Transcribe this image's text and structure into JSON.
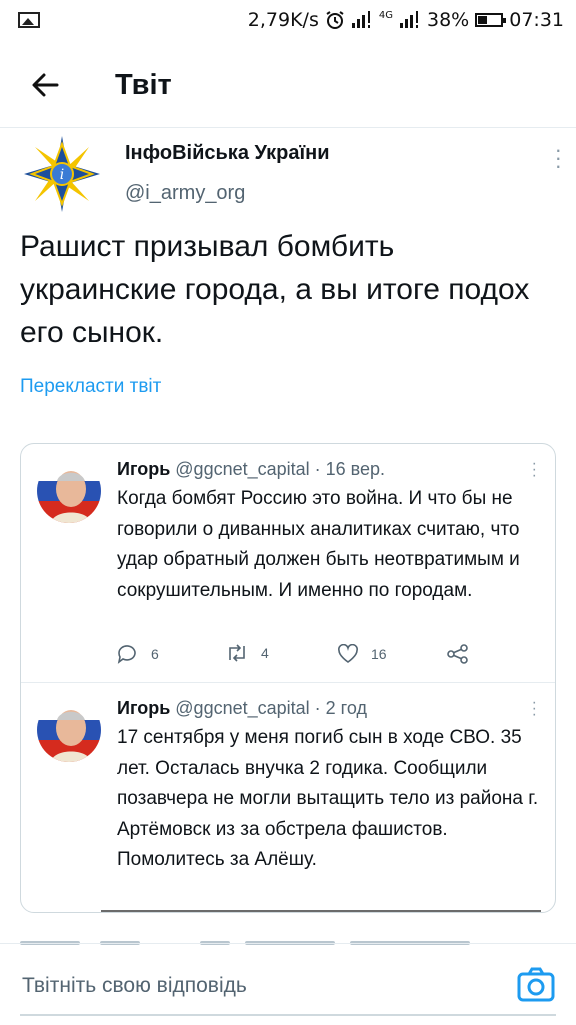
{
  "status_bar": {
    "left_icon": "image-icon",
    "net_speed": "2,79K/s",
    "network": "4G",
    "battery": "38%",
    "time": "07:31"
  },
  "header": {
    "title": "Твіт",
    "back_icon": "arrow-left-icon"
  },
  "tweet": {
    "author_name": "ІнфоВійська України",
    "author_handle": "@i_army_org",
    "text": "Рашист призывал бомбить украинские города, а вы итоге подох его сынок.",
    "translate_label": "Перекласти твіт"
  },
  "quoted": [
    {
      "name": "Игорь",
      "handle": "@ggcnet_capital",
      "time": "· 16 вер.",
      "text": "Когда бомбят Россию это война. И что бы не говорили о диванных аналитиках считаю, что удар обратный должен быть неотвратимым и сокрушительным. И именно по городам.",
      "replies": "6",
      "retweets": "4",
      "likes": "16"
    },
    {
      "name": "Игорь",
      "handle": "@ggcnet_capital",
      "time": "· 2 год",
      "text": "17 сентября у меня погиб сын в ходе СВО. 35 лет. Осталась внучка 2 годика. Сообщили позавчера не могли вытащить тело из района г. Артёмовск из за обстрела фашистов. Помолитесь за Алёшу."
    }
  ],
  "reply": {
    "placeholder": "Твітніть свою відповідь"
  },
  "colors": {
    "accent": "#1d9bf0",
    "text": "#0f1419",
    "secondary": "#536471"
  }
}
